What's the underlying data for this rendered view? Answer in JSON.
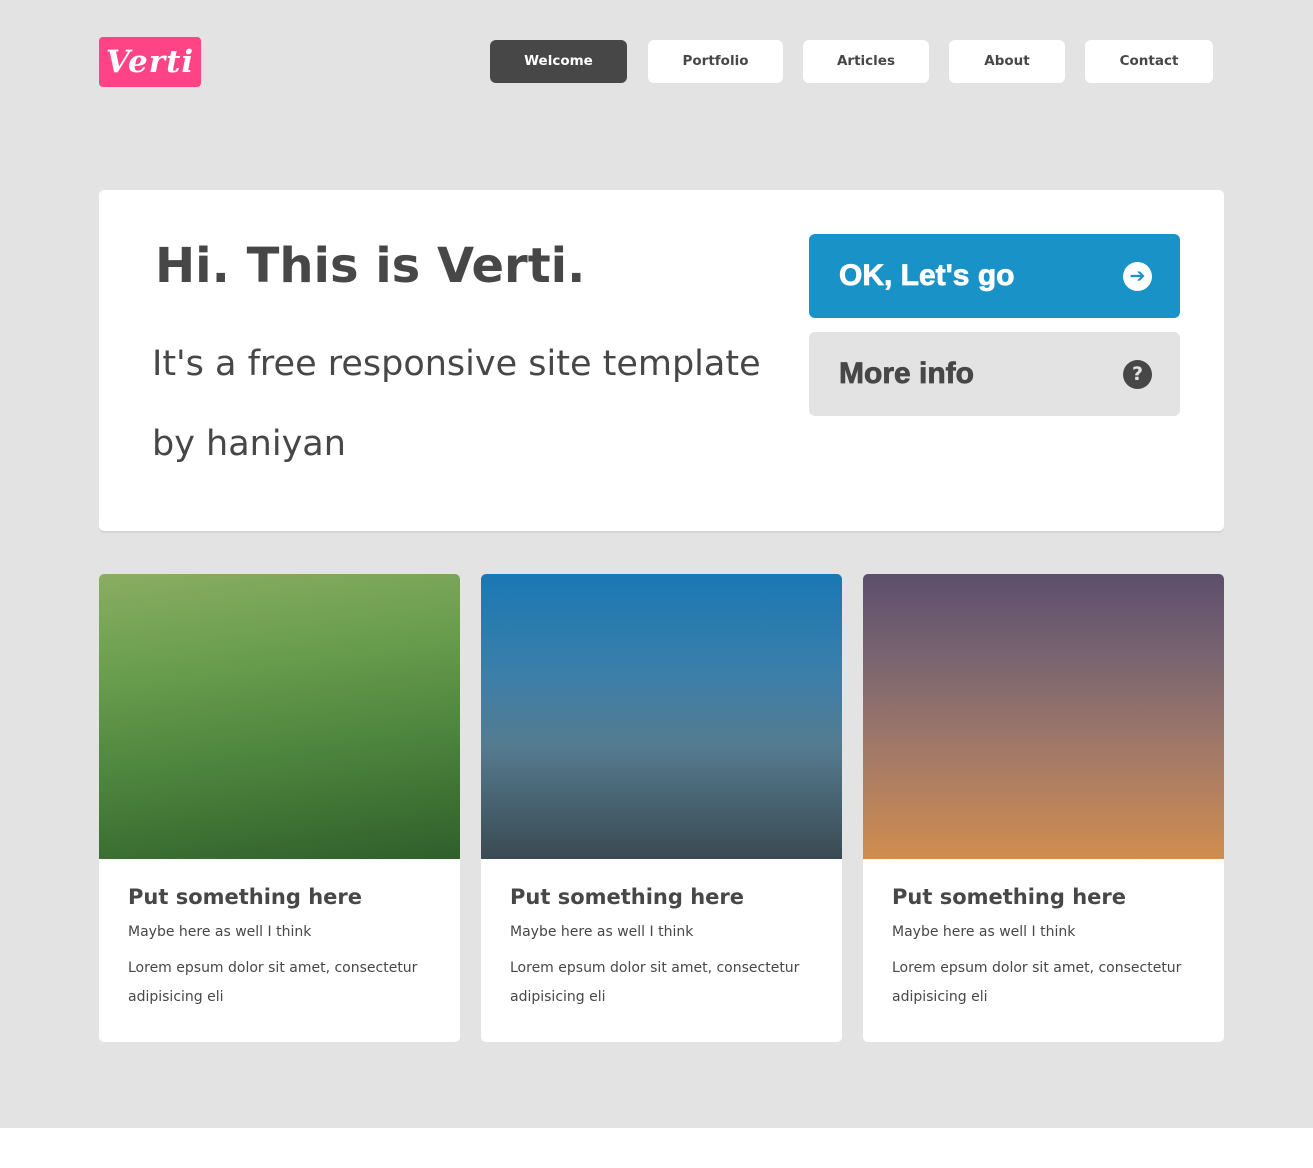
{
  "header": {
    "logo_text": "Verti",
    "logo_color": "#ff4486",
    "nav": [
      {
        "label": "Welcome",
        "active": true
      },
      {
        "label": "Portfolio",
        "active": false
      },
      {
        "label": "Articles",
        "active": false
      },
      {
        "label": "About",
        "active": false
      },
      {
        "label": "Contact",
        "active": false
      }
    ]
  },
  "banner": {
    "title": "Hi. This is Verti.",
    "subtitle": "It's a free responsive site template by haniyan",
    "primary_button": {
      "label": "OK, Let's go",
      "icon": "arrow-right-circle-icon",
      "color": "#1992c8"
    },
    "secondary_button": {
      "label": "More info",
      "icon": "question-circle-icon"
    }
  },
  "cards": [
    {
      "title": "Put something here",
      "subtitle": "Maybe here as well I think",
      "text": "Lorem epsum dolor sit amet, consectetur adipisicing eli"
    },
    {
      "title": "Put something here",
      "subtitle": "Maybe here as well I think",
      "text": "Lorem epsum dolor sit amet, consectetur adipisicing eli"
    },
    {
      "title": "Put something here",
      "subtitle": "Maybe here as well I think",
      "text": "Lorem epsum dolor sit amet, consectetur adipisicing eli"
    }
  ]
}
